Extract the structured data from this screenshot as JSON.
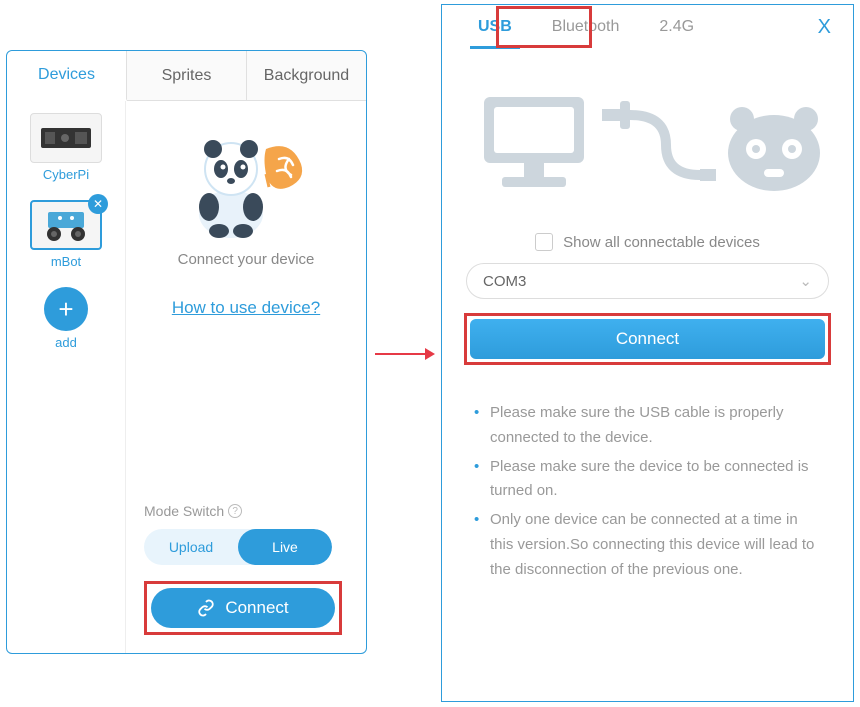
{
  "left": {
    "tabs": {
      "devices": "Devices",
      "sprites": "Sprites",
      "background": "Background"
    },
    "devices": {
      "cyberpi": "CyberPi",
      "mbot": "mBot",
      "add": "add"
    },
    "main": {
      "connect_prompt": "Connect your device",
      "howto": "How to use device?",
      "mode_label": "Mode Switch",
      "upload": "Upload",
      "live": "Live",
      "connect_btn": "Connect"
    }
  },
  "right": {
    "tabs": {
      "usb": "USB",
      "bluetooth": "Bluetooth",
      "g24": "2.4G"
    },
    "close": "X",
    "showall": "Show all connectable devices",
    "port": "COM3",
    "connect_btn": "Connect",
    "notes": [
      "Please make sure the USB cable is properly connected to the device.",
      "Please make sure the device to be connected is turned on.",
      "Only one device can be connected at a time in this version.So connecting this device will lead to the disconnection of the previous one."
    ]
  }
}
